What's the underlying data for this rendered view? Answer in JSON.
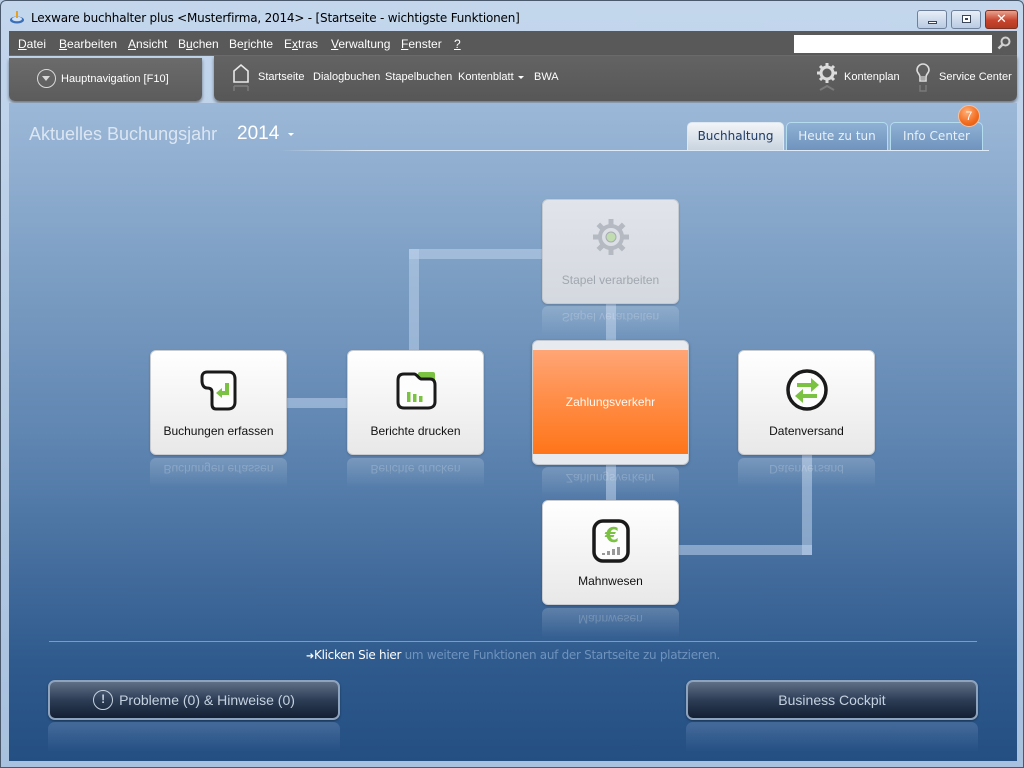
{
  "window": {
    "title": "Lexware buchhalter plus <Musterfirma,  2014> - [Startseite - wichtigste Funktionen]",
    "controls": {
      "minimize": "minimize",
      "maximize": "maximize",
      "close": "✕"
    }
  },
  "menubar": {
    "items": [
      {
        "pre": "",
        "key": "D",
        "post": "atei"
      },
      {
        "pre": "",
        "key": "B",
        "post": "earbeiten"
      },
      {
        "pre": "",
        "key": "A",
        "post": "nsicht"
      },
      {
        "pre": "B",
        "key": "u",
        "post": "chen"
      },
      {
        "pre": "Be",
        "key": "r",
        "post": "ichte"
      },
      {
        "pre": "E",
        "key": "x",
        "post": "tras"
      },
      {
        "pre": "",
        "key": "V",
        "post": "erwaltung"
      },
      {
        "pre": "",
        "key": "F",
        "post": "enster"
      },
      {
        "pre": "",
        "key": "?",
        "post": ""
      }
    ],
    "search": {
      "value": "",
      "placeholder": ""
    }
  },
  "navigation": {
    "main_nav_label": "Hauptnavigation [F10]",
    "quick_links": [
      "Startseite",
      "Dialogbuchen",
      "Stapelbuchen",
      "Kontenblatt",
      "BWA"
    ],
    "right_links": [
      "Kontenplan",
      "Service Center"
    ]
  },
  "header": {
    "fiscal_year_label": "Aktuelles Buchungsjahr",
    "fiscal_year_value": "2014",
    "tabs": [
      {
        "label": "Buchhaltung",
        "active": true
      },
      {
        "label": "Heute zu tun",
        "active": false
      },
      {
        "label": "Info Center",
        "active": false,
        "badge": "7"
      }
    ]
  },
  "tiles": {
    "stapel": {
      "label": "Stapel verarbeiten",
      "enabled": false
    },
    "buchungen": {
      "label": "Buchungen erfassen"
    },
    "berichte": {
      "label": "Berichte drucken"
    },
    "zahlungsverkehr": {
      "label": "Zahlungsverkehr",
      "highlighted": true
    },
    "datenversand": {
      "label": "Datenversand"
    },
    "mahnwesen": {
      "label": "Mahnwesen"
    }
  },
  "hint": {
    "link": "Klicken Sie hier",
    "text": " um weitere Funktionen auf der Startseite zu platzieren."
  },
  "buttons": {
    "problems": "Probleme (0) & Hinweise (0)",
    "cockpit": "Business Cockpit"
  },
  "colors": {
    "accent_orange": "#ff7f2a",
    "icon_green": "#7cc242",
    "background_top": "#9cb8d8",
    "background_bottom": "#244f83"
  }
}
